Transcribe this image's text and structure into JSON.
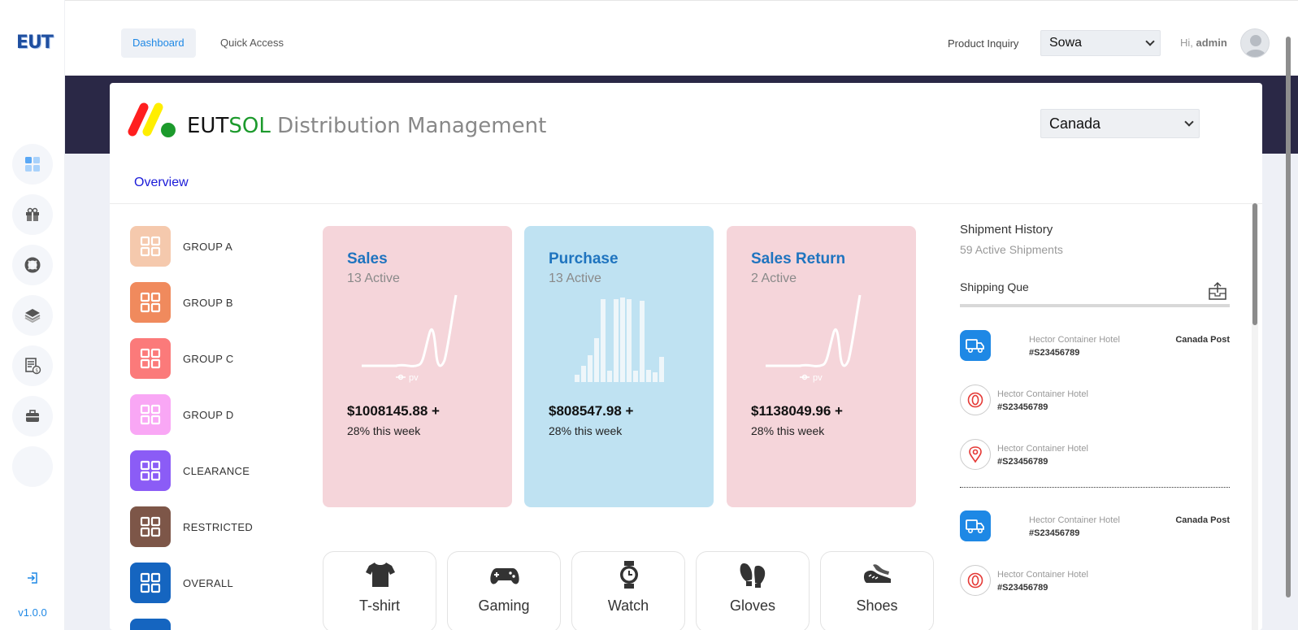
{
  "app": {
    "logo_text": "EUT",
    "version": "v1.0.0"
  },
  "rail": {
    "items": [
      {
        "icon": "dashboard-icon"
      },
      {
        "icon": "gift-icon"
      },
      {
        "icon": "lifebuoy-icon"
      },
      {
        "icon": "layers-icon"
      },
      {
        "icon": "invoice-icon"
      },
      {
        "icon": "briefcase-icon"
      },
      {
        "icon": "blank"
      }
    ],
    "logout_icon": "logout-icon"
  },
  "topbar": {
    "tabs": [
      {
        "label": "Dashboard",
        "active": true
      },
      {
        "label": "Quick Access",
        "active": false
      }
    ],
    "inquiry_label": "Product Inquiry",
    "inquiry_selected": "Sowa",
    "greeting": "Hi,",
    "username": "admin"
  },
  "brand": {
    "eut": "EUT",
    "sol": "SOL",
    "title": "Distribution Management",
    "country_selected": "Canada",
    "colors": {
      "red": "#ff1f1f",
      "yellow": "#ffee00",
      "green": "#1c9a2c"
    }
  },
  "tabs": {
    "overview": "Overview"
  },
  "groups": [
    {
      "label": "GROUP A",
      "color": "#f5c9ad"
    },
    {
      "label": "GROUP B",
      "color": "#f08a5d"
    },
    {
      "label": "GROUP C",
      "color": "#fb7a7a"
    },
    {
      "label": "GROUP D",
      "color": "#f9a7f5"
    },
    {
      "label": "CLEARANCE",
      "color": "#8b5cf6"
    },
    {
      "label": "RESTRICTED",
      "color": "#7d5648"
    },
    {
      "label": "OVERALL",
      "color": "#1565c0"
    }
  ],
  "stats": [
    {
      "title": "Sales",
      "sub": "13 Active",
      "amount": "$1008145.88 +",
      "week": "28% this week",
      "bg": "#f5d5da",
      "chart": "line",
      "chart_label": "pv"
    },
    {
      "title": "Purchase",
      "sub": "13 Active",
      "amount": "$808547.98 +",
      "week": "28% this week",
      "bg": "#bfe2f2",
      "chart": "bars",
      "chart_label": ""
    },
    {
      "title": "Sales Return",
      "sub": "2 Active",
      "amount": "$1138049.96 +",
      "week": "28% this week",
      "bg": "#f5d5da",
      "chart": "line",
      "chart_label": "pv"
    }
  ],
  "categories": [
    {
      "label": "T-shirt",
      "icon": "tshirt-icon"
    },
    {
      "label": "Gaming",
      "icon": "gamepad-icon"
    },
    {
      "label": "Watch",
      "icon": "watch-icon"
    },
    {
      "label": "Gloves",
      "icon": "gloves-icon"
    },
    {
      "label": "Shoes",
      "icon": "shoes-icon"
    }
  ],
  "shipments": {
    "title": "Shipment History",
    "subtitle": "59 Active Shipments",
    "queue_label": "Shipping Que",
    "rows": [
      {
        "icon": "truck-icon",
        "name": "Hector Container Hotel",
        "id": "#S23456789",
        "carrier": "Canada Post"
      },
      {
        "icon": "target-icon",
        "name": "Hector Container Hotel",
        "id": "#S23456789",
        "carrier": ""
      },
      {
        "icon": "pin-icon",
        "name": "Hector Container Hotel",
        "id": "#S23456789",
        "carrier": ""
      },
      {
        "icon": "truck-icon",
        "name": "Hector Container Hotel",
        "id": "#S23456789",
        "carrier": "Canada Post"
      },
      {
        "icon": "target-icon",
        "name": "Hector Container Hotel",
        "id": "#S23456789",
        "carrier": ""
      }
    ]
  }
}
